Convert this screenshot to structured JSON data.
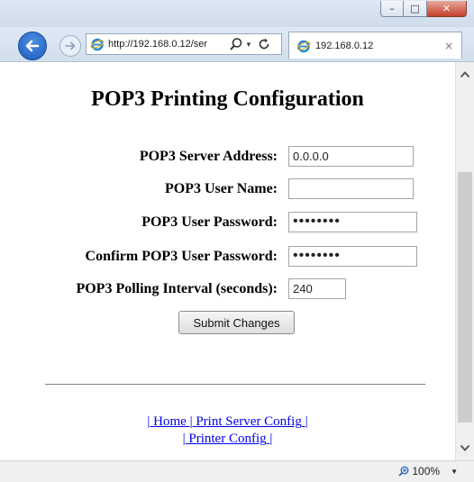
{
  "window": {
    "minimize_glyph": "–",
    "maximize_glyph": "□",
    "close_glyph": "✕"
  },
  "browser": {
    "address_url": "http://192.168.0.12/ser",
    "tab_title": "192.168.0.12",
    "tab_close_glyph": "×",
    "zoom": "100%"
  },
  "page": {
    "title": "POP3 Printing Configuration",
    "fields": {
      "server_address": {
        "label": "POP3 Server Address:",
        "value": "0.0.0.0"
      },
      "user_name": {
        "label": "POP3 User Name:",
        "value": ""
      },
      "user_password": {
        "label": "POP3 User Password:",
        "value": "••••••••"
      },
      "confirm_password": {
        "label": "Confirm POP3 User Password:",
        "value": "••••••••"
      },
      "polling_interval": {
        "label": "POP3 Polling Interval (seconds):",
        "value": "240"
      }
    },
    "submit_label": "Submit Changes",
    "links": {
      "sep_open": "|",
      "home": "Home",
      "sep1": "|",
      "print_server_config": "Print Server Config",
      "sep2": "|",
      "sep3": "|",
      "printer_config": "Printer Config",
      "sep4": "|"
    }
  },
  "icons": {
    "back": "back-arrow-icon",
    "forward": "forward-arrow-icon",
    "ie": "internet-explorer-icon",
    "search": "search-icon",
    "refresh": "refresh-icon",
    "zoom": "zoom-icon"
  },
  "colors": {
    "link": "#0000ee",
    "close_button": "#c4402a",
    "back_button": "#1b5cbf"
  }
}
